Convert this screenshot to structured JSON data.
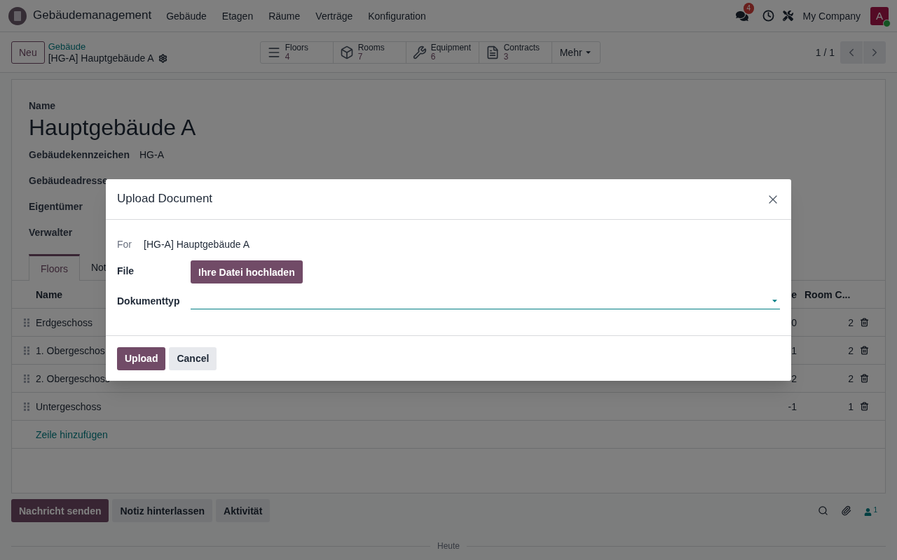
{
  "navbar": {
    "app_name": "Gebäudemanagement",
    "menu": [
      "Gebäude",
      "Etagen",
      "Räume",
      "Verträge",
      "Konfiguration"
    ],
    "messages_badge": "4",
    "company": "My Company",
    "avatar_letter": "A",
    "online": true
  },
  "control_panel": {
    "new_button": "Neu",
    "breadcrumb": {
      "parent": "Gebäude",
      "current": "[HG-A] Hauptgebäude A"
    },
    "stat_buttons": [
      {
        "kind": "floors",
        "label": "Floors",
        "value": "4"
      },
      {
        "kind": "rooms",
        "label": "Rooms",
        "value": "7"
      },
      {
        "kind": "equipment",
        "label": "Equipment",
        "value": "6"
      },
      {
        "kind": "contracts",
        "label": "Contracts",
        "value": "3"
      }
    ],
    "more_button": "Mehr",
    "pager": "1 / 1"
  },
  "form": {
    "name_label": "Name",
    "title": "Hauptgebäude A",
    "fields": [
      {
        "label": "Gebäudekennzeichen",
        "value": "HG-A"
      },
      {
        "label": "Gebäudeadresse"
      },
      {
        "label": "Eigentümer"
      },
      {
        "label": "Verwalter"
      }
    ],
    "tabs": [
      {
        "label": "Floors",
        "selected": true
      },
      {
        "label": "Not",
        "selected": false
      }
    ],
    "table": {
      "columns": [
        "Name",
        "e",
        "Room C..."
      ],
      "rows": [
        {
          "name": "Erdgeschoss",
          "column_2": "0",
          "room_count": "2"
        },
        {
          "name": "1. Obergeschos",
          "column_2": "1",
          "room_count": "2"
        },
        {
          "name": "2. Obergeschoss",
          "column_2": "2",
          "room_count": "2"
        },
        {
          "name": "Untergeschoss",
          "column_2": "-1",
          "room_count": "1"
        }
      ],
      "add_line": "Zeile hinzufügen"
    }
  },
  "chatter": {
    "buttons": [
      {
        "label": "Nachricht senden",
        "kind": "primary"
      },
      {
        "label": "Notiz hinterlassen",
        "kind": "secondary"
      },
      {
        "label": "Aktivität",
        "kind": "secondary"
      }
    ],
    "followers": "1",
    "divider": "Heute"
  },
  "dialog": {
    "title": "Upload Document",
    "for_label": "For",
    "for_value": "[HG-A] Hauptgebäude A",
    "file_label": "File",
    "upload_file_button": "Ihre Datei hochladen",
    "document_type_label": "Dokumenttyp",
    "buttons": [
      {
        "label": "Upload",
        "kind": "primary"
      },
      {
        "label": "Cancel",
        "kind": "secondary"
      }
    ]
  }
}
